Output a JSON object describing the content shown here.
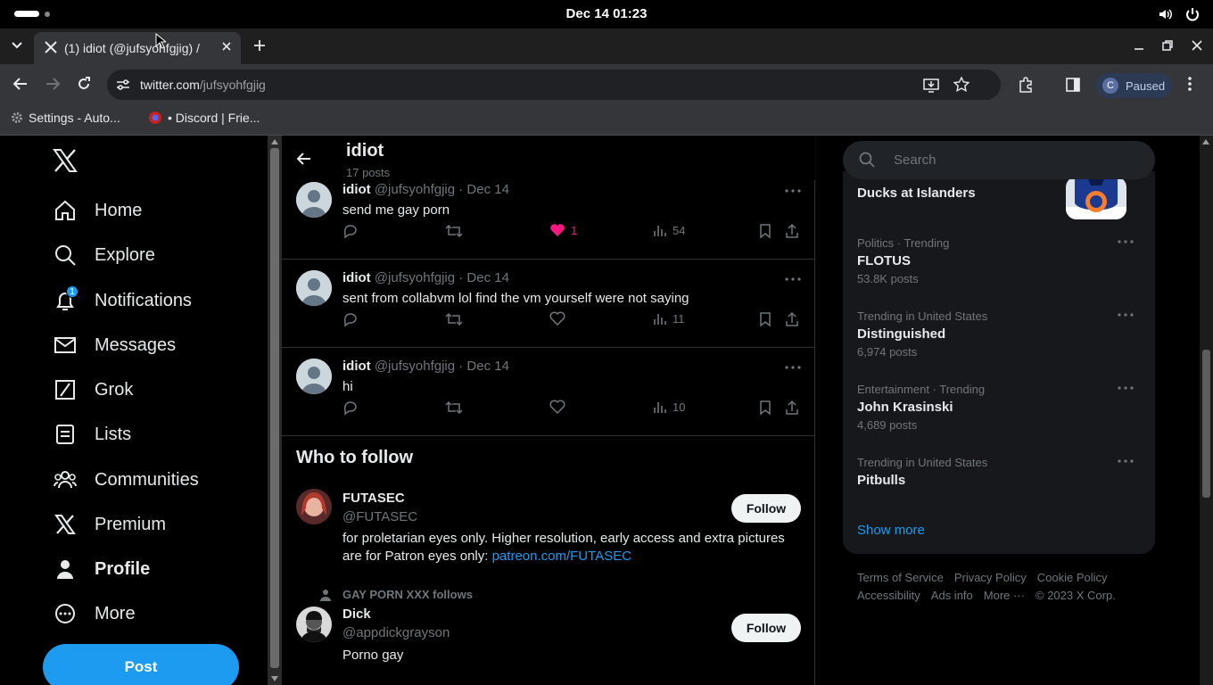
{
  "system": {
    "clock": "Dec 14  01:23"
  },
  "browser": {
    "tab_title": "(1) idiot (@jufsyohfgjig) /",
    "url_host": "twitter.com",
    "url_path": "/jufsyohfgjig",
    "profile_label": "Paused",
    "profile_initial": "C",
    "bookmarks": [
      "Settings - Auto...",
      "• Discord | Frie..."
    ]
  },
  "nav": {
    "items": [
      {
        "label": "Home",
        "icon": "home-icon"
      },
      {
        "label": "Explore",
        "icon": "search-icon"
      },
      {
        "label": "Notifications",
        "icon": "bell-icon",
        "badge": "1"
      },
      {
        "label": "Messages",
        "icon": "mail-icon"
      },
      {
        "label": "Grok",
        "icon": "grok-icon"
      },
      {
        "label": "Lists",
        "icon": "list-icon"
      },
      {
        "label": "Communities",
        "icon": "communities-icon"
      },
      {
        "label": "Premium",
        "icon": "x-icon"
      },
      {
        "label": "Profile",
        "icon": "person-icon"
      },
      {
        "label": "More",
        "icon": "more-circle-icon"
      }
    ],
    "post_label": "Post"
  },
  "header": {
    "name": "idiot",
    "post_count": "17 posts"
  },
  "tweets": [
    {
      "name": "idiot",
      "handle": "@jufsyohfgjig · Dec 14",
      "text": "send me gay porn",
      "likes": "1",
      "liked": true,
      "views": "54"
    },
    {
      "name": "idiot",
      "handle": "@jufsyohfgjig · Dec 14",
      "text": "sent from collabvm lol find the vm yourself were not saying",
      "likes": "",
      "liked": false,
      "views": "11"
    },
    {
      "name": "idiot",
      "handle": "@jufsyohfgjig · Dec 14",
      "text": "hi",
      "likes": "",
      "liked": false,
      "views": "10"
    }
  ],
  "who_to_follow": {
    "title": "Who to follow",
    "follow_label": "Follow",
    "accounts": [
      {
        "name": "FUTASEC",
        "handle": "@FUTASEC",
        "bio": "for proletarian eyes only. Higher resolution, early access and extra pictures are for Patron eyes only: ",
        "bio_link": "patreon.com/FUTASEC"
      },
      {
        "context": "GAY PORN XXX follows",
        "name": "Dick",
        "handle": "@appdickgrayson",
        "bio": "Porno gay"
      }
    ]
  },
  "search": {
    "placeholder": "Search"
  },
  "trends": [
    {
      "context": "",
      "title": "Ducks at Islanders",
      "posts": ""
    },
    {
      "context": "Politics · Trending",
      "title": "FLOTUS",
      "posts": "53.8K posts"
    },
    {
      "context": "Trending in United States",
      "title": "Distinguished",
      "posts": "6,974 posts"
    },
    {
      "context": "Entertainment · Trending",
      "title": "John Krasinski",
      "posts": "4,689 posts"
    },
    {
      "context": "Trending in United States",
      "title": "Pitbulls",
      "posts": ""
    }
  ],
  "show_more": "Show more",
  "footer": {
    "line1": [
      "Terms of Service",
      "Privacy Policy",
      "Cookie Policy"
    ],
    "line2": [
      "Accessibility",
      "Ads info",
      "More ···",
      "© 2023 X Corp."
    ]
  },
  "colors": {
    "accent": "#1d9bf0",
    "like": "#f91880",
    "background": "#000000"
  }
}
